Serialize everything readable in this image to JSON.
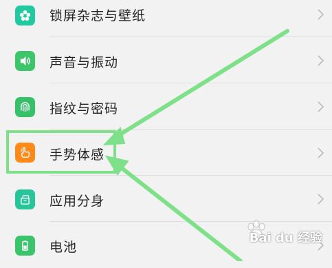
{
  "settings": {
    "items": [
      {
        "label": "锁屏杂志与壁纸",
        "icon": "flower-icon",
        "color": "#20c9a0"
      },
      {
        "label": "声音与振动",
        "icon": "speaker-icon",
        "color": "#3ec46b"
      },
      {
        "label": "指纹与密码",
        "icon": "fingerprint-icon",
        "color": "#37c06a"
      },
      {
        "label": "手势体感",
        "icon": "hand-gesture-icon",
        "color": "#ff8a1a"
      },
      {
        "label": "应用分身",
        "icon": "app-clone-icon",
        "color": "#28c49a"
      },
      {
        "label": "电池",
        "icon": "battery-icon",
        "color": "#3cc46d"
      }
    ]
  },
  "annotation": {
    "highlight_color": "#7fe08a"
  },
  "watermark": {
    "text": "Bai du 经验"
  }
}
